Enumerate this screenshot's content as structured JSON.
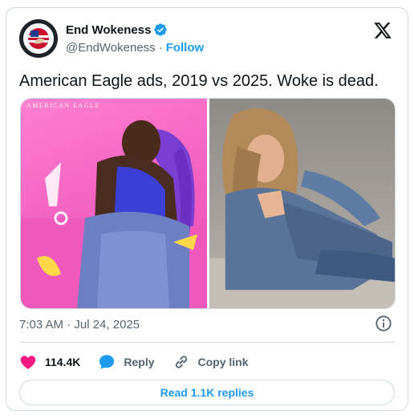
{
  "user": {
    "display_name": "End Wokeness",
    "handle": "@EndWokeness",
    "separator": "·",
    "follow_label": "Follow",
    "avatar_badge_top": "ENDWOKENESS",
    "avatar_badge_bottom": "PATRIOTS"
  },
  "tweet": {
    "text": "American Eagle ads, 2019 vs 2025. Woke is dead.",
    "media_left_label": "AMERICAN EAGLE",
    "timestamp": "7:03 AM · Jul 24, 2025"
  },
  "actions": {
    "like_count": "114.4K",
    "reply_label": "Reply",
    "copy_link_label": "Copy link",
    "read_replies_label": "Read 1.1K replies"
  },
  "colors": {
    "brand_blue": "#1d9bf0",
    "like_pink": "#f91880",
    "text_primary": "#0f1419",
    "text_secondary": "#536471",
    "border": "#cfd9de"
  },
  "icons": {
    "verified": "verified-badge-icon",
    "x_logo": "x-logo-icon",
    "info": "info-icon",
    "like": "heart-icon",
    "reply": "speech-bubble-icon",
    "copy_link": "link-icon"
  }
}
